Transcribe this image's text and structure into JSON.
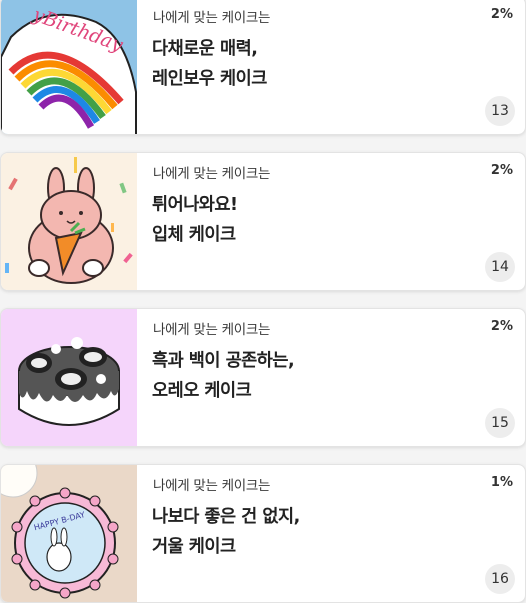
{
  "cards": [
    {
      "subtitle": "나에게 맞는 케이크는",
      "percent": "2%",
      "title_line1": "다채로운 매력,",
      "title_line2": "레인보우 케이크",
      "count": "13",
      "thumb_bg": "#8ec3e6",
      "image_text": "yBirthday"
    },
    {
      "subtitle": "나에게 맞는 케이크는",
      "percent": "2%",
      "title_line1": "튀어나와요!",
      "title_line2": "입체 케이크",
      "count": "14",
      "thumb_bg": "#fbf1e3"
    },
    {
      "subtitle": "나에게 맞는 케이크는",
      "percent": "2%",
      "title_line1": "흑과 백이 공존하는,",
      "title_line2": "오레오 케이크",
      "count": "15",
      "thumb_bg": "#f5d5fb"
    },
    {
      "subtitle": "나에게 맞는 케이크는",
      "percent": "1%",
      "title_line1": "나보다 좋은 건 없지,",
      "title_line2": "거울 케이크",
      "count": "16",
      "thumb_bg": "#ead8c8",
      "image_text": "HAPPY B-DAY"
    }
  ]
}
